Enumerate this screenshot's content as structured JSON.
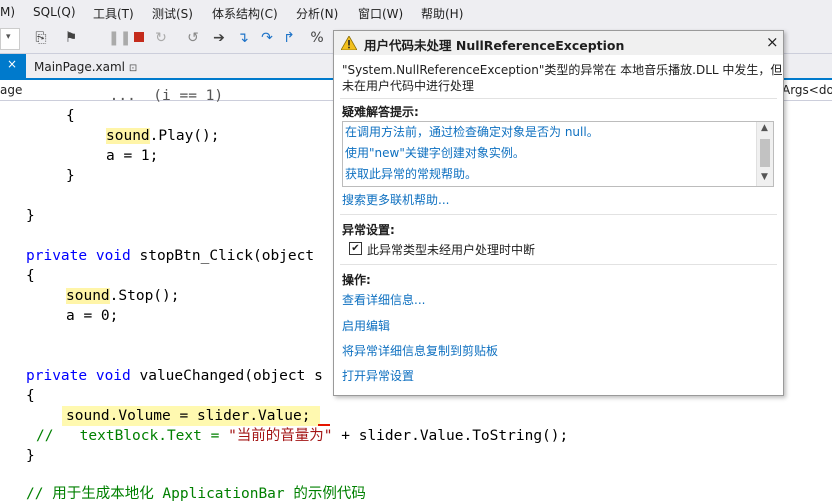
{
  "menu": [
    "M)",
    "SQL(Q)",
    "工具(T)",
    "测试(S)",
    "体系结构(C)",
    "分析(N)",
    "窗口(W)",
    "帮助(H)"
  ],
  "tabs": {
    "main_label": "MainPage.xaml",
    "pin_glyph": "⊡"
  },
  "navbar": {
    "left_text": "age",
    "right_text": "Args<do"
  },
  "code": {
    "l0": "     ...  (i == 1)",
    "l1_brace": "{",
    "l2_a": "sound",
    "l2_b": ".Play();",
    "l3": "a = 1;",
    "l4_brace": "}",
    "l6_brace": "}",
    "l8_kw": "private void",
    "l8_name": " stopBtn_Click(object",
    "l9_brace": "{",
    "l10_a": "sound",
    "l10_b": ".Stop();",
    "l11": "a = 0;",
    "l13_kw": "private void",
    "l13_name": " valueChanged(object s",
    "l14_brace": "{",
    "l15": "sound.Volume = slider.Value;",
    "l16_cm": "//   textBlock.Text = ",
    "l16_str": "\"当前的音量为\"",
    "l16_rest": " + slider.Value.ToString();",
    "l17_brace": "}",
    "l19_cm": "// 用于生成本地化 ApplicationBar 的示例代码"
  },
  "dialog": {
    "title": "用户代码未处理 NullReferenceException",
    "close_glyph": "×",
    "message_line1": "\"System.NullReferenceException\"类型的异常在 本地音乐播放.DLL 中发生，但",
    "message_line2": "未在用户代码中进行处理",
    "tips_header": "疑难解答提示:",
    "tips": [
      "在调用方法前，通过检查确定对象是否为 null。",
      "使用\"new\"关键字创建对象实例。",
      "获取此异常的常规帮助。"
    ],
    "more_help": "搜索更多联机帮助...",
    "settings_header": "异常设置:",
    "checkbox_label": "此异常类型未经用户处理时中断",
    "checkbox_checked": true,
    "actions_header": "操作:",
    "actions": [
      "查看详细信息...",
      "启用编辑",
      "将异常详细信息复制到剪贴板",
      "打开异常设置"
    ]
  },
  "icons": [
    "warning-icon",
    "close-icon",
    "stop-icon",
    "pause-icon",
    "restart-icon",
    "step-into-icon",
    "step-over-icon",
    "step-out-icon",
    "checkmark-icon"
  ],
  "colors": {
    "accent": "#007acc",
    "link": "#0e70c0",
    "keyword": "#0000ff",
    "comment": "#008000",
    "string": "#a31515",
    "highlight": "#fff9b0"
  }
}
